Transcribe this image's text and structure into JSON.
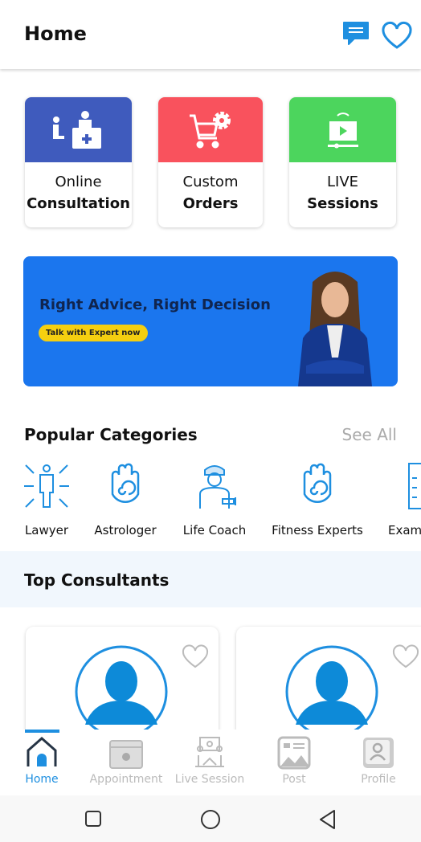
{
  "header": {
    "title": "Home",
    "icons": [
      "chat-icon",
      "heart-icon"
    ]
  },
  "tiles": [
    {
      "line1": "Online",
      "line2": "Consultation",
      "color": "#3f5bbd",
      "icon": "consultation-icon"
    },
    {
      "line1": "Custom",
      "line2": "Orders",
      "color": "#f9525d",
      "icon": "cart-gear-icon"
    },
    {
      "line1": "LIVE",
      "line2": "Sessions",
      "color": "#4cd55d",
      "icon": "live-stream-icon"
    }
  ],
  "banner": {
    "headline": "Right Advice, Right Decision",
    "button": "Talk with Expert now",
    "color": "#1b76ee"
  },
  "popular": {
    "title": "Popular Categories",
    "see_all": "See All",
    "items": [
      {
        "label": "Lawyer",
        "icon": "lawyer-icon"
      },
      {
        "label": "Astrologer",
        "icon": "hand-spiral-icon"
      },
      {
        "label": "Life Coach",
        "icon": "coach-icon"
      },
      {
        "label": "Fitness Experts",
        "icon": "hand-spiral-icon"
      },
      {
        "label": "Exam",
        "icon": "checklist-icon"
      }
    ]
  },
  "top_consultants": {
    "title": "Top Consultants"
  },
  "bottom_nav": {
    "active": "Home",
    "accent": "#1e8fe0",
    "items": [
      "Home",
      "Appointment",
      "Live Session",
      "Post",
      "Profile"
    ]
  }
}
